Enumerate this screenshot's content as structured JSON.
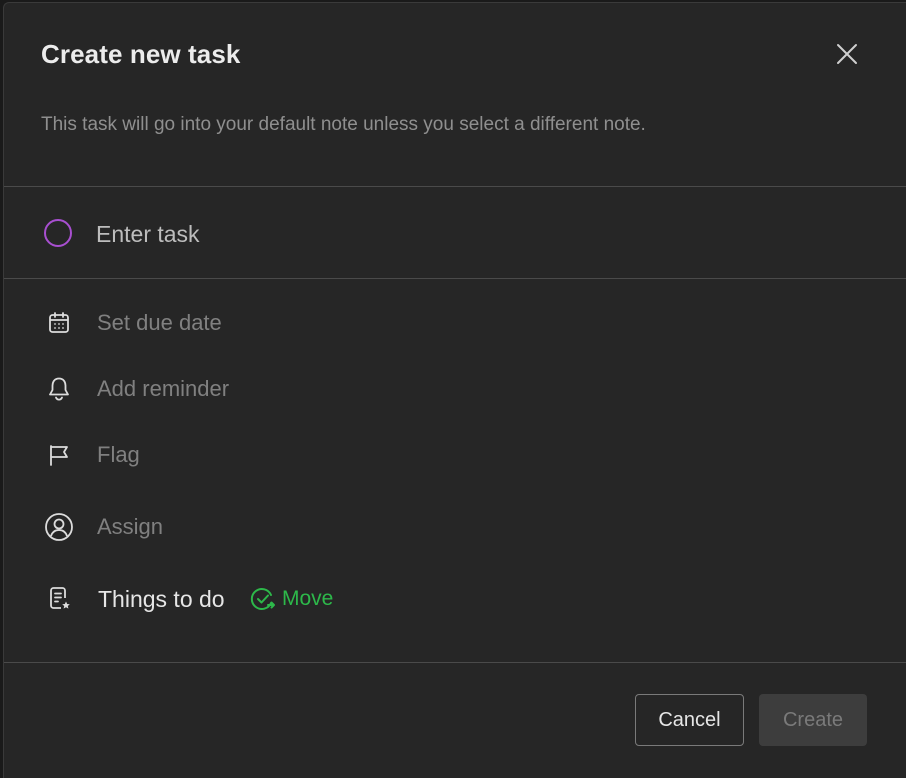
{
  "dialog": {
    "title": "Create new task",
    "subtitle": "This task will go into your default note unless you select a different note."
  },
  "task": {
    "placeholder": "Enter task",
    "value": ""
  },
  "options": {
    "due_date": {
      "label": "Set due date",
      "icon": "calendar-icon"
    },
    "reminder": {
      "label": "Add reminder",
      "icon": "bell-icon"
    },
    "flag": {
      "label": "Flag",
      "icon": "flag-icon"
    },
    "assign": {
      "label": "Assign",
      "icon": "person-circle-icon"
    }
  },
  "note": {
    "name": "Things to do",
    "icon": "note-star-icon",
    "move_label": "Move",
    "move_icon": "check-circle-arrow-icon"
  },
  "buttons": {
    "cancel": "Cancel",
    "create": "Create"
  },
  "colors": {
    "background": "#262626",
    "accent_purple": "#a84fd0",
    "move_green": "#2db84a",
    "muted_text": "#808080"
  }
}
